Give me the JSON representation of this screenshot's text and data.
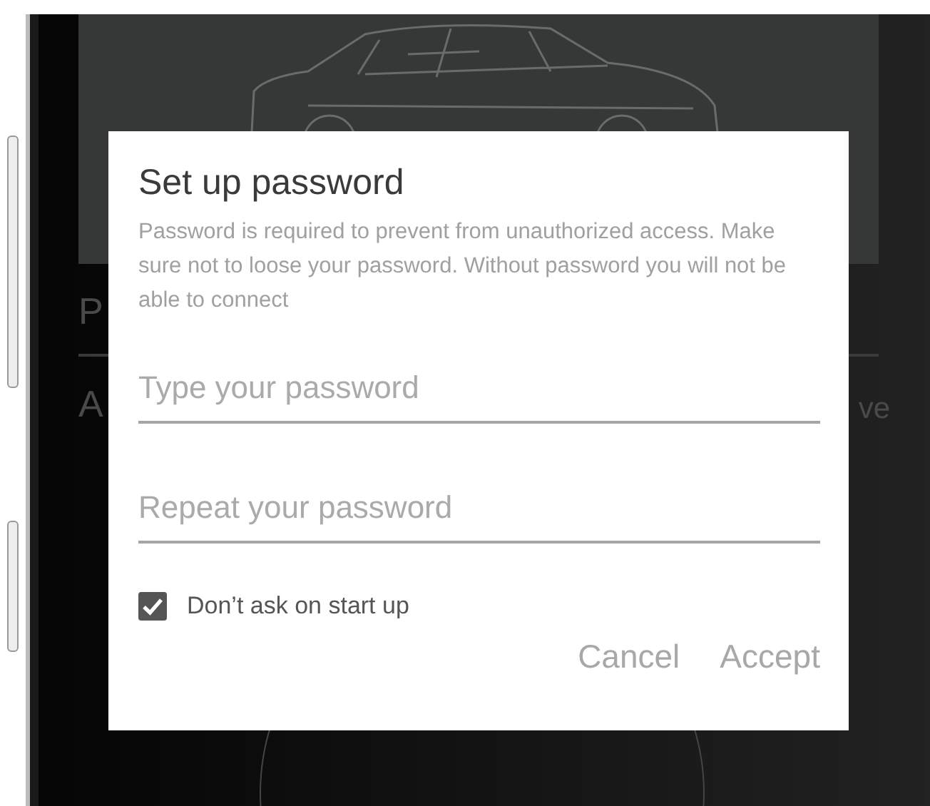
{
  "background": {
    "rows": [
      {
        "left": "P"
      },
      {
        "left": "A",
        "right": "ve"
      }
    ]
  },
  "dialog": {
    "title": "Set up password",
    "message": "Password is required to prevent from unauthorized access. Make sure not to loose your password. Without password you will not be able to connect",
    "fields": [
      {
        "placeholder": "Type your password"
      },
      {
        "placeholder": "Repeat your password"
      }
    ],
    "checkbox": {
      "label": "Don’t ask on start up",
      "checked": true
    },
    "buttons": [
      "Cancel",
      "Accept"
    ]
  }
}
